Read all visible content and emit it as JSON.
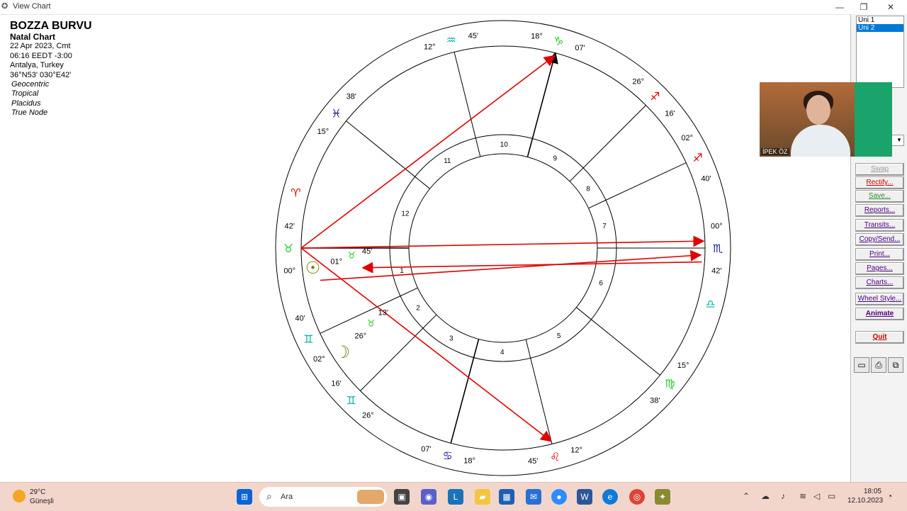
{
  "window": {
    "title": "View Chart",
    "icon": "chart-app-icon"
  },
  "info": {
    "name": "BOZZA BURVU",
    "chart_type": "Natal Chart",
    "date": "22 Apr 2023, Cmt",
    "time": "06:16  EEDT -3:00",
    "place": "Antalya, Turkey",
    "coords": "36°N53' 030°E42'",
    "options": [
      "Geocentric",
      "Tropical",
      "Placidus",
      "True Node"
    ]
  },
  "wheel": {
    "houses": [
      "1",
      "2",
      "3",
      "4",
      "5",
      "6",
      "7",
      "8",
      "9",
      "10",
      "11",
      "12"
    ],
    "cusps": [
      {
        "deg": "00°",
        "sign": "♉",
        "min": "42'"
      },
      {
        "deg": "02°",
        "sign": "♊",
        "min": "40'"
      },
      {
        "deg": "26°",
        "sign": "♊",
        "min": "16'"
      },
      {
        "deg": "18°",
        "sign": "♋",
        "min": "07'"
      },
      {
        "deg": "12°",
        "sign": "♌",
        "min": "45'"
      },
      {
        "deg": "15°",
        "sign": "♍",
        "min": "38'"
      },
      {
        "deg": "00°",
        "sign": "♏",
        "min": "42'"
      },
      {
        "deg": "02°",
        "sign": "♐",
        "min": "40'"
      },
      {
        "deg": "26°",
        "sign": "♐",
        "min": "16'"
      },
      {
        "deg": "18°",
        "sign": "♑",
        "min": "07'"
      },
      {
        "deg": "12°",
        "sign": "♒",
        "min": "45'"
      },
      {
        "deg": "15°",
        "sign": "♓",
        "min": "38'"
      }
    ],
    "intercepted": [
      {
        "sign": "♈"
      },
      {
        "sign": "♎"
      }
    ],
    "planets": [
      {
        "glyph": "☉",
        "deg": "01°",
        "sign": "♉",
        "min": "45'"
      },
      {
        "glyph": "☽",
        "deg": "26°",
        "sign": "♉",
        "min": "13'"
      }
    ],
    "colors": {
      "aspect_red": "#e00000",
      "ring": "#000000",
      "fire": "#e00000",
      "earth": "#22cc22",
      "air": "#00b0b0",
      "water": "#1a1aa0",
      "sun": "#7a7a00"
    }
  },
  "sidebar": {
    "list": [
      "Uni 1",
      "Uni 2"
    ],
    "list_selected": "Uni 2",
    "buttons": {
      "swap": "Swap",
      "rectify": "Rectify...",
      "save": "Save...",
      "reports": "Reports...",
      "transits": "Transits...",
      "copysend": "Copy/Send...",
      "print": "Print...",
      "pages": "Pages...",
      "charts": "Charts...",
      "wheelstyle": "Wheel Style...",
      "animate": "Animate",
      "quit": "Quit"
    }
  },
  "video": {
    "participant": "İPEK ÖZ"
  },
  "taskbar": {
    "temp": "29°C",
    "weather": "Güneşli",
    "search_placeholder": "Ara",
    "time": "18:05",
    "date": "12.10.2023"
  }
}
